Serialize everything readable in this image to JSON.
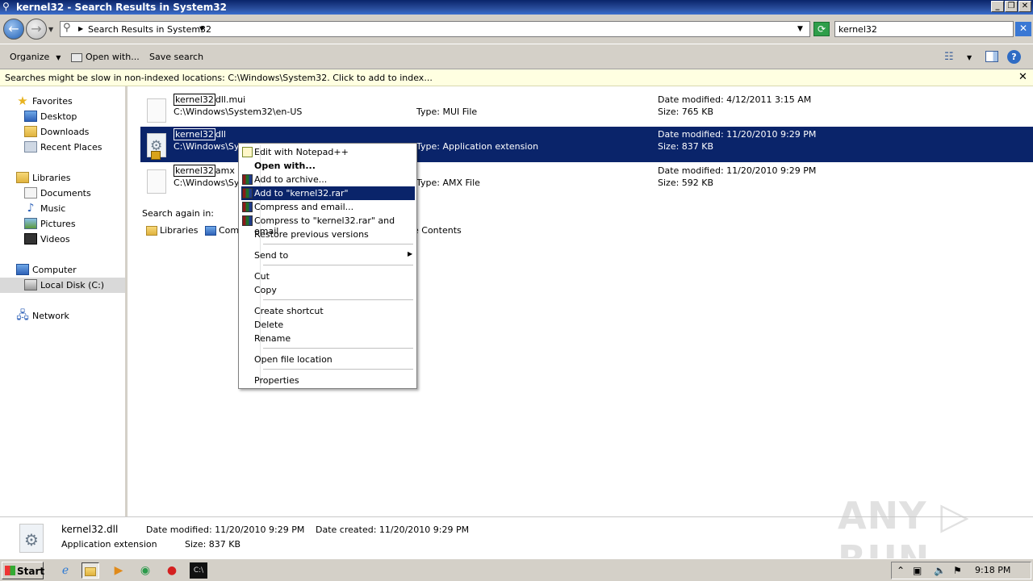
{
  "window": {
    "title": "kernel32 - Search Results in System32",
    "controls": {
      "minimize": "_",
      "restore": "❐",
      "close": "✕"
    }
  },
  "address": {
    "breadcrumb": "Search Results in System32",
    "search_value": "kernel32"
  },
  "toolbar": {
    "organize": "Organize",
    "open_with": "Open with...",
    "save_search": "Save search"
  },
  "infobar": {
    "text": "Searches might be slow in non-indexed locations: C:\\Windows\\System32. Click to add to index...",
    "close": "✕"
  },
  "nav": {
    "favorites": "Favorites",
    "desktop": "Desktop",
    "downloads": "Downloads",
    "recent_places": "Recent Places",
    "libraries": "Libraries",
    "documents": "Documents",
    "music": "Music",
    "pictures": "Pictures",
    "videos": "Videos",
    "computer": "Computer",
    "local_disk": "Local Disk (C:)",
    "network": "Network"
  },
  "results": [
    {
      "match": "kernel32",
      "suffix": "dll.mui",
      "path": "C:\\Windows\\System32\\en-US",
      "type": "Type: MUI File",
      "date": "Date modified: 4/12/2011 3:15 AM",
      "size": "Size: 765 KB"
    },
    {
      "match": "kernel32",
      "suffix": "dll",
      "path": "C:\\Windows\\Sys",
      "type": "Type: Application extension",
      "date": "Date modified: 11/20/2010 9:29 PM",
      "size": "Size: 837 KB"
    },
    {
      "match": "kernel32",
      "suffix": "amx",
      "path": "C:\\Windows\\Sys",
      "type": "Type: AMX File",
      "date": "Date modified: 11/20/2010 9:29 PM",
      "size": "Size: 592 KB"
    }
  ],
  "search_again": {
    "label": "Search again in:",
    "libraries": "Libraries",
    "computer": "Comp",
    "contents": "e Contents"
  },
  "context_menu": {
    "edit_notepadpp": "Edit with Notepad++",
    "open_with": "Open with...",
    "add_archive": "Add to archive...",
    "add_rar": "Add to \"kernel32.rar\"",
    "compress_email": "Compress and email...",
    "compress_rar_email": "Compress to \"kernel32.rar\" and email",
    "restore_versions": "Restore previous versions",
    "send_to": "Send to",
    "cut": "Cut",
    "copy": "Copy",
    "create_shortcut": "Create shortcut",
    "delete": "Delete",
    "rename": "Rename",
    "open_location": "Open file location",
    "properties": "Properties"
  },
  "details": {
    "name": "kernel32.dll",
    "type": "Application extension",
    "modified": "Date modified: 11/20/2010 9:29 PM",
    "size": "Size: 837 KB",
    "created": "Date created: 11/20/2010 9:29 PM"
  },
  "watermark": "ANY ▷ RUN",
  "taskbar": {
    "start": "Start",
    "clock": "9:18 PM"
  }
}
